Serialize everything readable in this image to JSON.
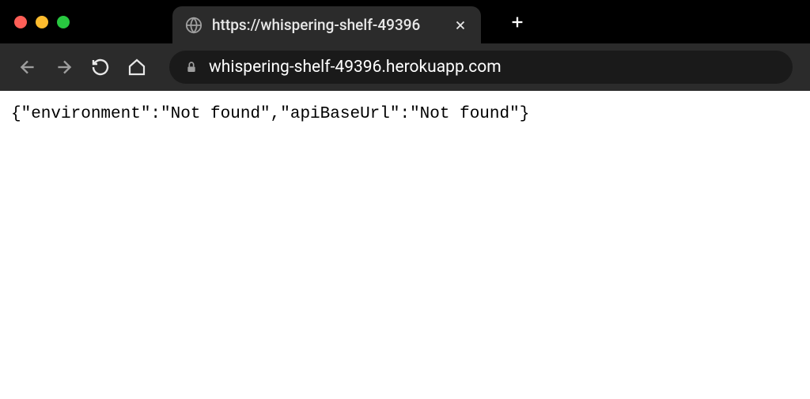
{
  "tab": {
    "title": "https://whispering-shelf-49396"
  },
  "address": {
    "url": "whispering-shelf-49396.herokuapp.com"
  },
  "page": {
    "body": "{\"environment\":\"Not found\",\"apiBaseUrl\":\"Not found\"}"
  }
}
